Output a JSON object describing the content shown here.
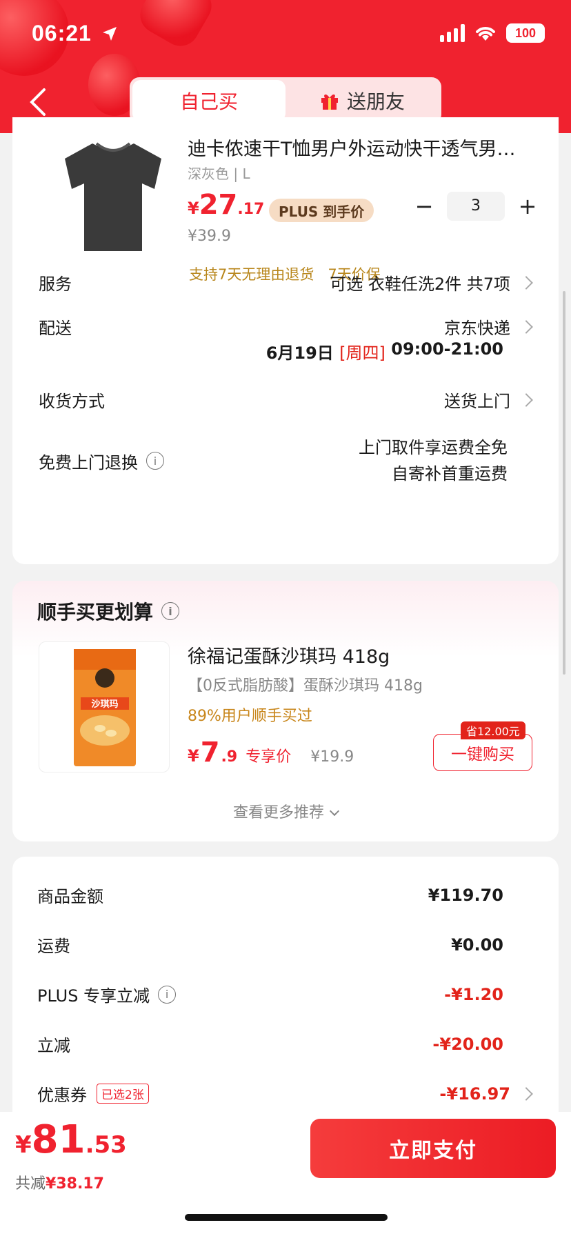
{
  "status_bar": {
    "time": "06:21",
    "battery": "100"
  },
  "header": {
    "tabs": [
      {
        "label": "自己买",
        "active": true
      },
      {
        "label": "送朋友",
        "active": false
      }
    ],
    "accent": "#f0222f"
  },
  "product": {
    "title": "迪卡侬速干T恤男户外运动快干透气男…",
    "spec": "深灰色 | L",
    "price_yen": "¥",
    "price_int": "27",
    "price_dec": ".17",
    "plus_label": "PLUS 到手价",
    "old_price": "¥39.9",
    "quantity": "3",
    "guarantee": "支持7天无理由退货   7天价保"
  },
  "rows": {
    "service": {
      "label": "服务",
      "value": "可选 衣鞋任洗2件 共7项"
    },
    "delivery": {
      "label": "配送",
      "value": "京东快递",
      "date": "6月19日 ",
      "weekday": "[周四]",
      "time": " 09:00-21:00"
    },
    "receive": {
      "label": "收货方式",
      "value": "送货上门"
    },
    "free_return": {
      "label": "免费上门退换",
      "line1": "上门取件享运费全免",
      "line2": "自寄补首重运费"
    }
  },
  "recommend": {
    "title": "顺手买更划算",
    "name": "徐福记蛋酥沙琪玛 418g",
    "desc": "【0反式脂肪酸】蛋酥沙琪玛 418g",
    "bought": "89%用户顺手买过",
    "price_yen": "¥",
    "price_int": "7",
    "price_dec": ".9",
    "price_label": "专享价",
    "old_price": "¥19.9",
    "save_tag": "省12.00元",
    "buy_label": "一键购买",
    "more": "查看更多推荐",
    "package_text": "沙琪玛"
  },
  "summary": {
    "goods": {
      "label": "商品金额",
      "value": "¥119.70"
    },
    "shipping": {
      "label": "运费",
      "value": "¥0.00"
    },
    "plus": {
      "label": "PLUS 专享立减",
      "value": "-¥1.20"
    },
    "discount": {
      "label": "立减",
      "value": "-¥20.00"
    },
    "coupon": {
      "label": "优惠券",
      "badge": "已选2张",
      "value": "-¥16.97"
    }
  },
  "footer": {
    "total_yen": "¥",
    "total_int": "81",
    "total_dec": ".53",
    "saved_label": "共减",
    "saved_value": "¥38.17",
    "pay_label": "立即支付"
  }
}
